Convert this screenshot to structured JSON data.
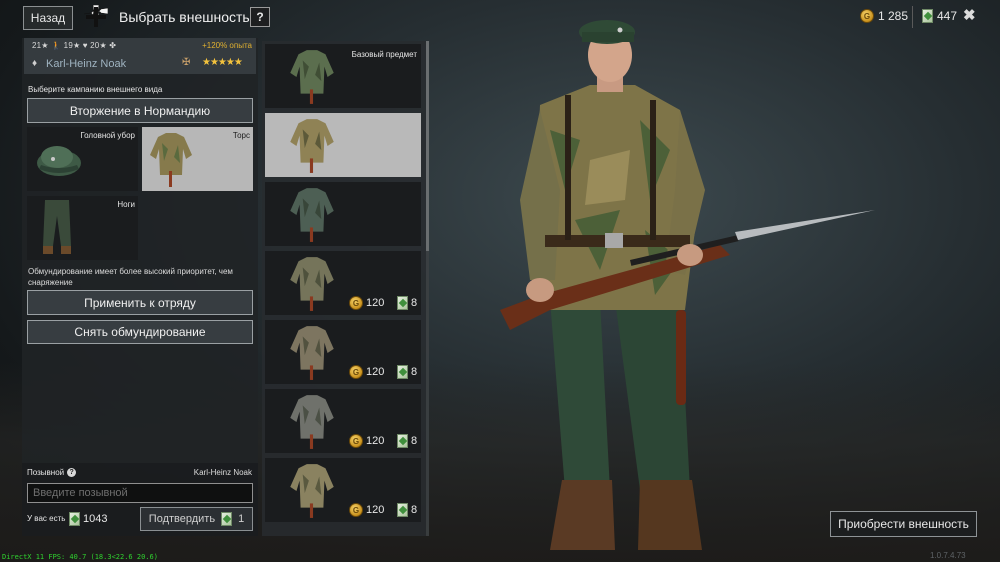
{
  "header": {
    "back_label": "Назад",
    "title": "Выбрать внешность",
    "help_label": "?",
    "gold_amount": "1 285",
    "tickets_amount": "447",
    "close_label": "✖",
    "faction_icon": "iron-cross-icon"
  },
  "soldier": {
    "stats": "21★ 🚶 19★ ♥ 20★ ✤",
    "exp_bonus": "+120% опыта",
    "name": "Karl-Heinz Noak",
    "stars": "★★★★★"
  },
  "appearance": {
    "campaign_prompt": "Выберите кампанию внешнего вида",
    "campaign_name": "Вторжение в Нормандию",
    "slots": [
      {
        "label": "Головной убор",
        "icon": "helmet-cap-icon",
        "selected": false
      },
      {
        "label": "Торс",
        "icon": "torso-jacket-icon",
        "selected": true
      },
      {
        "label": "Ноги",
        "icon": "trousers-icon",
        "selected": false
      }
    ],
    "priority_note": "Обмундирование имеет более высокий приоритет, чем снаряжение",
    "apply_label": "Применить к отряду",
    "remove_label": "Снять обмундирование"
  },
  "callsign": {
    "label": "Позывной",
    "owner": "Karl-Heinz Noak",
    "placeholder": "Введите позывной",
    "have_label": "У вас есть",
    "have_amount": "1043",
    "confirm_label": "Подтвердить",
    "confirm_cost": "1"
  },
  "items": [
    {
      "name": "Базовый предмет",
      "color": "#5b6e4e",
      "selected": false
    },
    {
      "name": "",
      "color": "#8f8255",
      "selected": true
    },
    {
      "name": "",
      "color": "#4d5f54",
      "selected": false
    },
    {
      "name": "",
      "gold": "120",
      "tickets": "8",
      "color": "#75745a",
      "selected": false
    },
    {
      "name": "",
      "gold": "120",
      "tickets": "8",
      "color": "#7d7560",
      "selected": false
    },
    {
      "name": "",
      "gold": "120",
      "tickets": "8",
      "color": "#6f716b",
      "selected": false
    },
    {
      "name": "",
      "gold": "120",
      "tickets": "8",
      "color": "#8a8260",
      "selected": false
    }
  ],
  "buy_label": "Приобрести внешность",
  "debug_text": "DirectX 11 FPS: 40.7 (18.3<22.6 20.6)",
  "version_text": "1.0.7.4.73"
}
